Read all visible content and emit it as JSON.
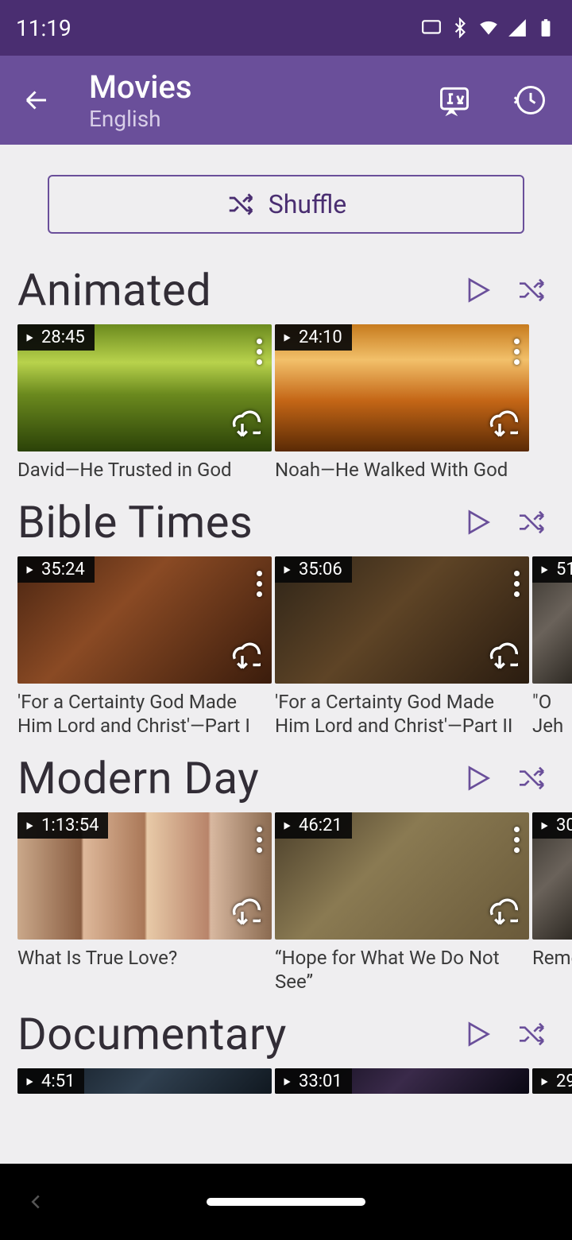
{
  "status": {
    "time": "11:19"
  },
  "header": {
    "title": "Movies",
    "subtitle": "English"
  },
  "shuffle_label": "Shuffle",
  "sections": [
    {
      "title": "Animated",
      "items": [
        {
          "duration": "28:45",
          "title": "David—He Trusted in God",
          "grad": "g-green"
        },
        {
          "duration": "24:10",
          "title": "Noah—He Walked With God",
          "grad": "g-orange"
        }
      ]
    },
    {
      "title": "Bible Times",
      "items": [
        {
          "duration": "35:24",
          "title": "'For a Certainty God Made Him Lord and Christ'—Part I",
          "grad": "g-brown"
        },
        {
          "duration": "35:06",
          "title": "'For a Certainty God Made Him Lord and Christ'—Part II",
          "grad": "g-tan"
        },
        {
          "duration": "51",
          "title": "\"O Jeh",
          "grad": "g-grey",
          "peek": true
        }
      ]
    },
    {
      "title": "Modern Day",
      "items": [
        {
          "duration": "1:13:54",
          "title": "What Is True Love?",
          "grad": "g-faces"
        },
        {
          "duration": "46:21",
          "title": "“Hope for What We Do Not See”",
          "grad": "g-couch"
        },
        {
          "duration": "30",
          "title": "Reme",
          "grad": "g-grey",
          "peek": true
        }
      ]
    },
    {
      "title": "Documentary",
      "items": [
        {
          "duration": "4:51",
          "title": "",
          "grad": "g-dark"
        },
        {
          "duration": "33:01",
          "title": "",
          "grad": "g-space"
        },
        {
          "duration": "29",
          "title": "",
          "grad": "g-grey",
          "peek": true
        }
      ]
    }
  ]
}
